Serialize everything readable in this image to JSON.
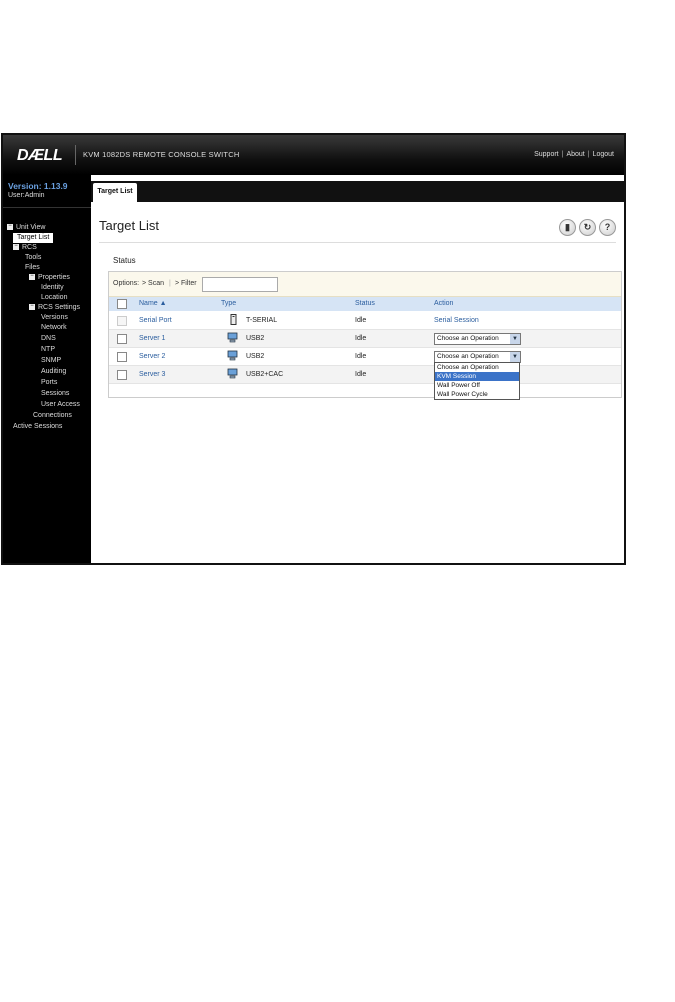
{
  "header": {
    "logo": "DÆLL",
    "product": "KVM 1082DS REMOTE CONSOLE SWITCH",
    "links": [
      "Support",
      "About",
      "Logout"
    ]
  },
  "sidebar": {
    "version": "Version: 1.13.9",
    "user": "User:Admin",
    "tree": [
      {
        "label": "Unit View"
      },
      {
        "label": "Target List",
        "selected": true
      },
      {
        "label": "RCS"
      },
      {
        "label": "Tools"
      },
      {
        "label": "Files"
      },
      {
        "label": "Properties"
      },
      {
        "label": "Identity"
      },
      {
        "label": "Location"
      },
      {
        "label": "RCS Settings"
      },
      {
        "label": "Versions"
      },
      {
        "label": "Network"
      },
      {
        "label": "DNS"
      },
      {
        "label": "NTP"
      },
      {
        "label": "SNMP"
      },
      {
        "label": "Auditing"
      },
      {
        "label": "Ports"
      },
      {
        "label": "Sessions"
      },
      {
        "label": "User Access"
      },
      {
        "label": "Connections"
      },
      {
        "label": "Active Sessions"
      }
    ]
  },
  "tabs": {
    "active": "Target List"
  },
  "main": {
    "title": "Target List",
    "status_label": "Status",
    "options": {
      "label": "Options:",
      "scan": "> Scan",
      "sep": "|",
      "filter": "> Filter",
      "filter_value": ""
    },
    "columns": {
      "name": "Name ▲",
      "type": "Type",
      "status": "Status",
      "action": "Action"
    },
    "rows": [
      {
        "name": "Serial Port",
        "type": "T-SERIAL",
        "status": "Idle",
        "action": "Serial Session",
        "icon": "serial-device-icon"
      },
      {
        "name": "Server 1",
        "type": "USB2",
        "status": "Idle",
        "action": "Choose an Operation",
        "icon": "computer-icon"
      },
      {
        "name": "Server 2",
        "type": "USB2",
        "status": "Idle",
        "action": "Choose an Operation",
        "icon": "computer-icon"
      },
      {
        "name": "Server 3",
        "type": "USB2+CAC",
        "status": "Idle",
        "action": "",
        "icon": "computer-icon"
      }
    ],
    "dropdown_options": [
      "Choose an Operation",
      "KVM Session",
      "Wall Power Off",
      "Wall Power Cycle"
    ],
    "highlighted_option": "KVM Session"
  },
  "colors": {
    "accent": "#2a5d9e",
    "highlight": "#3b73c8",
    "header_bg": "#d6e4f5"
  }
}
